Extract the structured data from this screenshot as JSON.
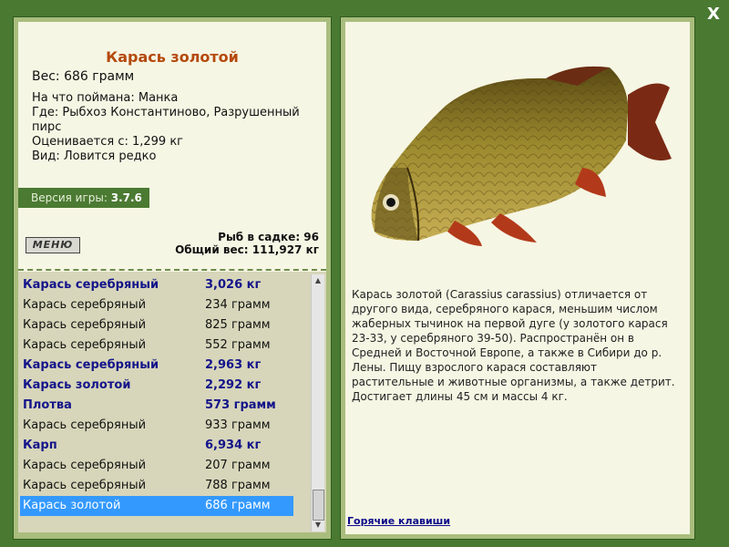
{
  "close_label": "X",
  "info": {
    "title": "Карась золотой",
    "weight_line": "Вес: 686 грамм",
    "details": [
      "На что поймана: Манка",
      "Где: Рыбхоз Константиново, Разрушенный пирс",
      "Оценивается с: 1,299 кг",
      "Вид: Ловится редко"
    ],
    "version_label": "Версия игры:",
    "version_value": "3.7.6",
    "menu_logo": "МЕНЮ",
    "stats_count": "Рыб в садке: 96",
    "stats_total": "Общий вес: 111,927 кг"
  },
  "catch_list": [
    {
      "name": "Карась серебряный",
      "weight": "3,026 кг",
      "bold": true
    },
    {
      "name": "Карась серебряный",
      "weight": "234 грамм",
      "bold": false
    },
    {
      "name": "Карась серебряный",
      "weight": "825 грамм",
      "bold": false
    },
    {
      "name": "Карась серебряный",
      "weight": "552 грамм",
      "bold": false
    },
    {
      "name": "Карась серебряный",
      "weight": "2,963 кг",
      "bold": true
    },
    {
      "name": "Карась золотой",
      "weight": "2,292 кг",
      "bold": true
    },
    {
      "name": "Плотва",
      "weight": "573 грамм",
      "bold": true
    },
    {
      "name": "Карась серебряный",
      "weight": "933 грамм",
      "bold": false
    },
    {
      "name": "Карп",
      "weight": "6,934 кг",
      "bold": true
    },
    {
      "name": "Карась серебряный",
      "weight": "207 грамм",
      "bold": false
    },
    {
      "name": "Карась серебряный",
      "weight": "788 грамм",
      "bold": false
    },
    {
      "name": "Карась золотой",
      "weight": "686 грамм",
      "bold": false,
      "selected": true
    }
  ],
  "description": "Карась золотой (Carassius carassius) отличается от другого вида, серебряного карася, меньшим числом жаберных тычинок на первой дуге (у золотого карася 23-33, у серебряного 39-50). Распространён он в Средней и Восточной Европе, а также в Сибири до р. Лены. Пищу взрослого карася составляют растительные и животные организмы, а также детрит. Достигает длины 45 см и массы 4 кг.",
  "hotkeys_link": "Горячие клавиши",
  "colors": {
    "background": "#4a7a32",
    "panel": "#f6f6e4",
    "title": "#b5490b",
    "selection": "#3399ff"
  }
}
